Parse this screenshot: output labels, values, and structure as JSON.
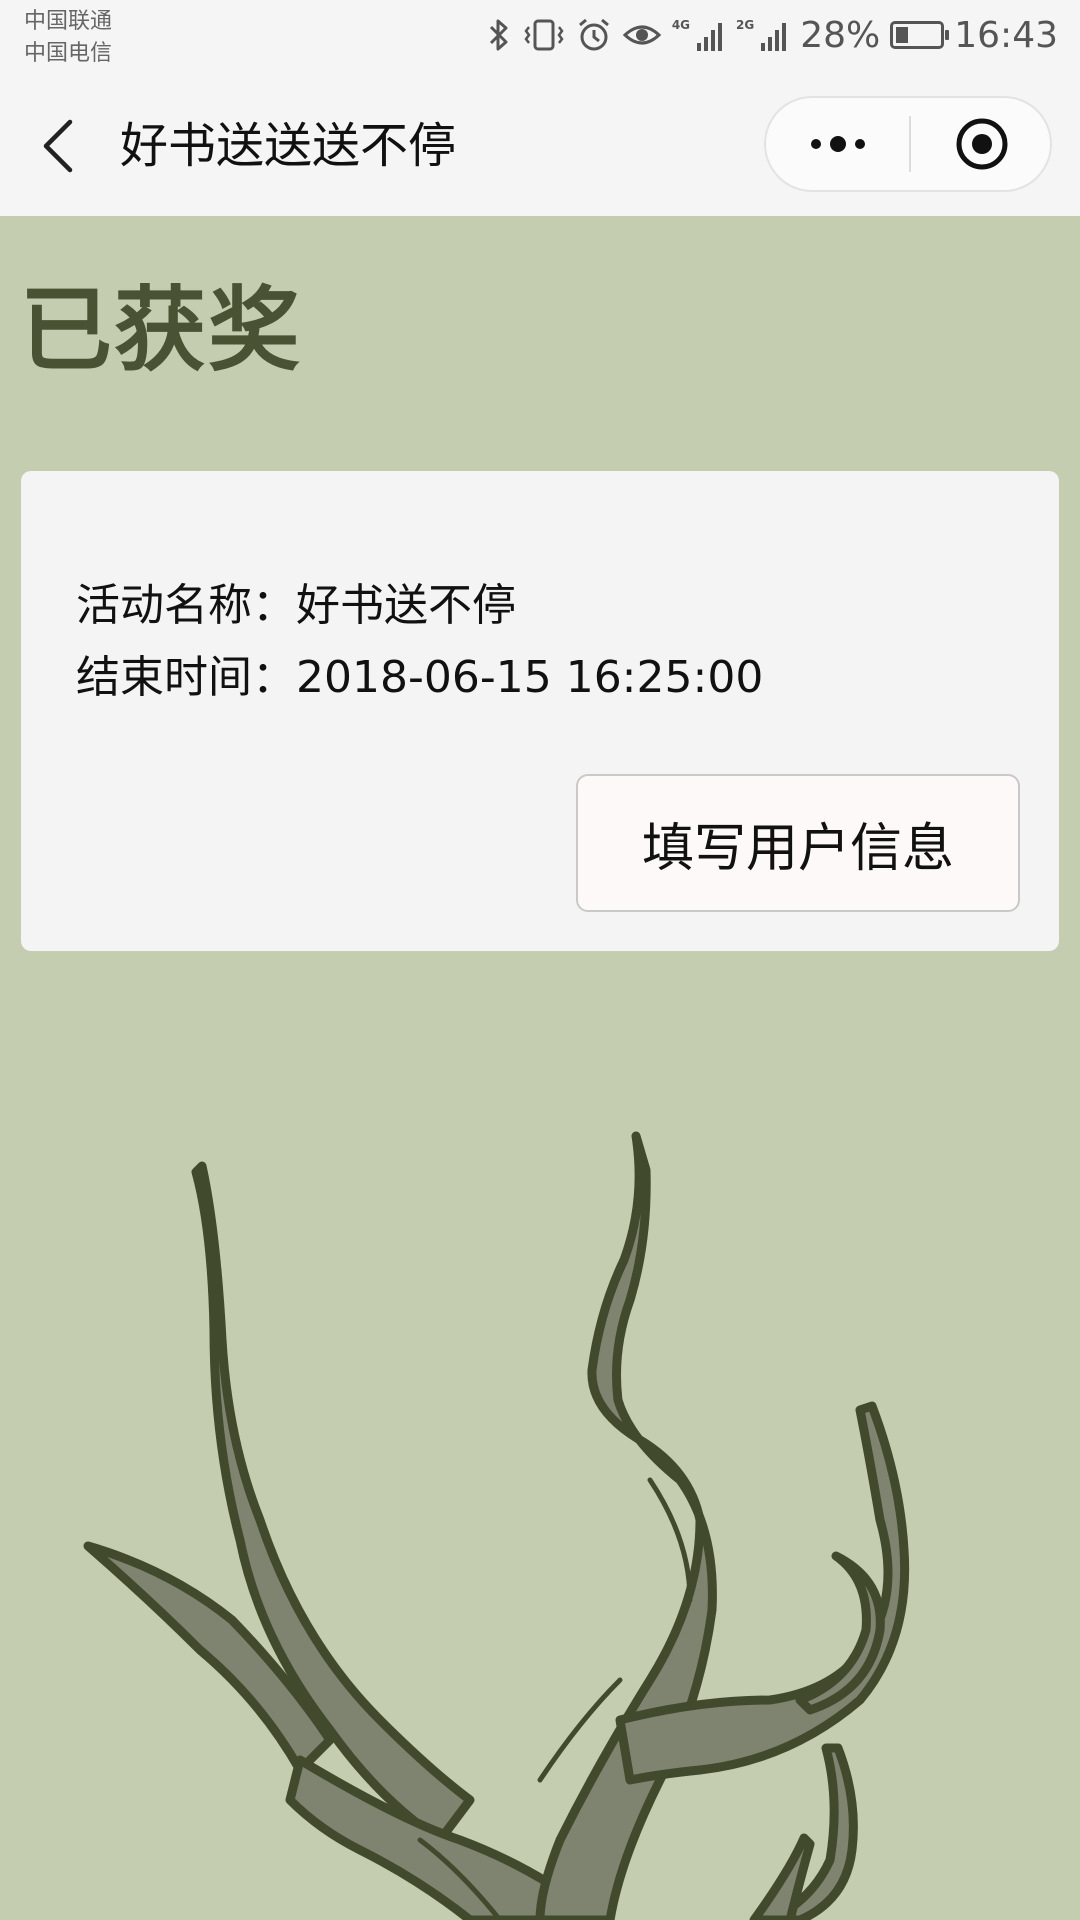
{
  "status_bar": {
    "carriers": [
      "中国联通",
      "中国电信"
    ],
    "network_1": "4G",
    "network_2": "2G",
    "battery_percent": "28%",
    "battery_level": 0.28,
    "time": "16:43",
    "icons": [
      "bluetooth-icon",
      "vibrate-icon",
      "alarm-icon",
      "eye-icon",
      "signal-icon",
      "battery-icon"
    ]
  },
  "nav": {
    "title": "好书送送送不停",
    "back_icon": "chevron-left-icon",
    "more_icon": "more-dots-icon",
    "close_icon": "target-circle-icon"
  },
  "main": {
    "heading": "已获奖",
    "card": {
      "activity_label": "活动名称：",
      "activity_value": "好书送不停",
      "end_label": "结束时间：",
      "end_value": "2018-06-15 16:25:00",
      "button_label": "填写用户信息"
    }
  },
  "colors": {
    "background": "#c4cdb0",
    "heading": "#4a5234",
    "card": "#f4f4f4",
    "tree_fill": "#7f8470",
    "tree_stroke": "#424a2e"
  }
}
